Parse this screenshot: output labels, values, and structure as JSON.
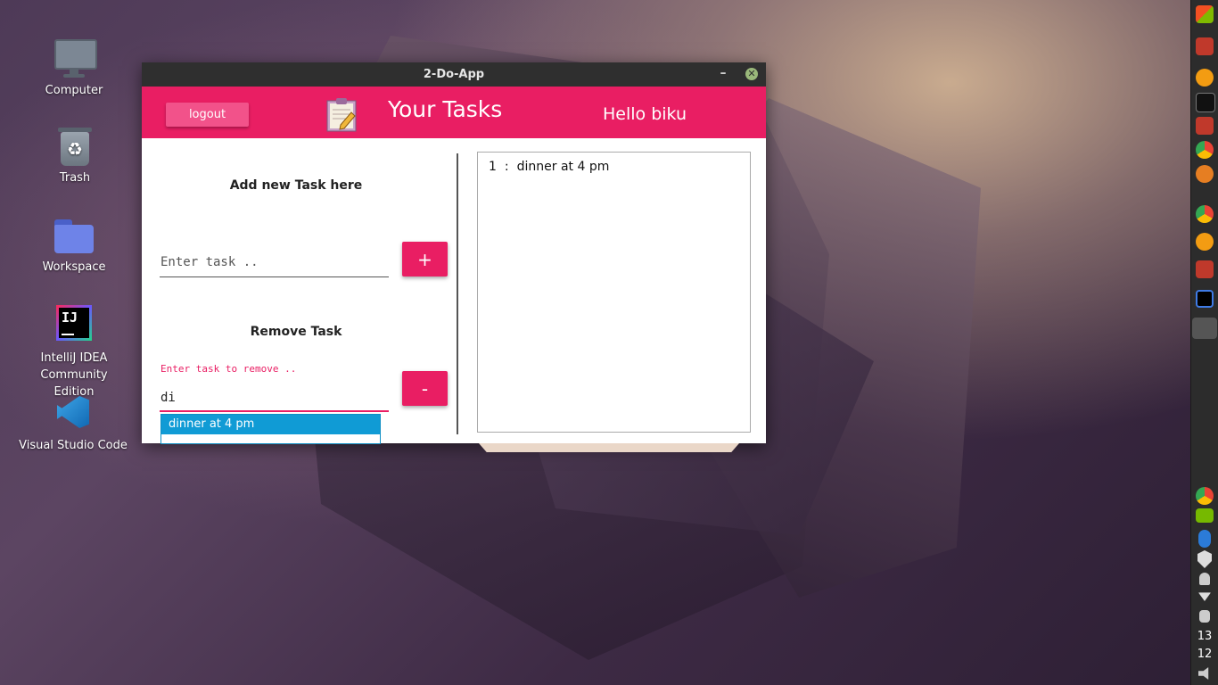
{
  "desktop": {
    "icons": [
      {
        "label": "Computer",
        "icon": "monitor-icon"
      },
      {
        "label": "Trash",
        "icon": "trash-icon"
      },
      {
        "label": "Workspace",
        "icon": "folder-icon"
      },
      {
        "label": "IntelliJ IDEA Community Edition",
        "icon": "intellij-icon"
      },
      {
        "label": "Visual Studio Code",
        "icon": "vscode-icon"
      }
    ]
  },
  "dock": {
    "clock_hour": "13",
    "clock_minute": "12"
  },
  "window": {
    "title": "2-Do-App",
    "minimize_glyph": "–",
    "close_glyph": "✕"
  },
  "header": {
    "logout_label": "logout",
    "title": "Your Tasks",
    "greeting": "Hello biku",
    "accent_color": "#e91e63"
  },
  "add_section": {
    "heading": "Add new Task here",
    "input_placeholder": "Enter task ..",
    "input_value": "",
    "button_label": "+"
  },
  "remove_section": {
    "heading": "Remove Task",
    "float_label": "Enter task to remove  ..",
    "input_value": "di",
    "button_label": "-",
    "autocomplete_options": [
      "dinner at 4 pm"
    ]
  },
  "task_list": {
    "items": [
      {
        "number": "1",
        "separator": ":",
        "text": "dinner at 4 pm"
      }
    ]
  }
}
